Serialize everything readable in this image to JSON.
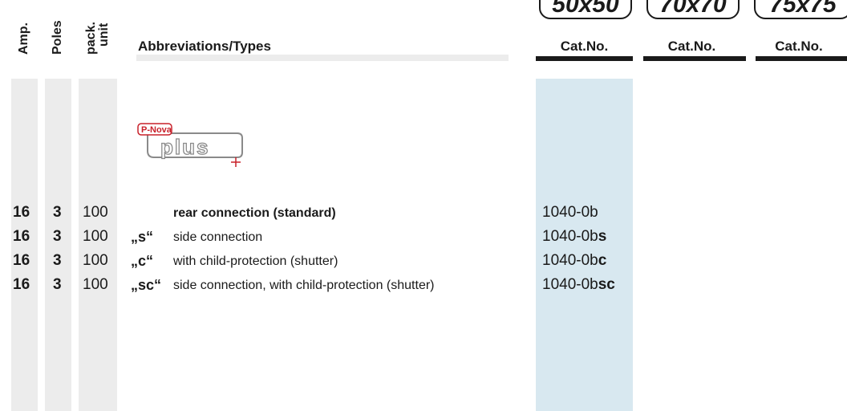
{
  "headers": {
    "amp": "Amp.",
    "poles": "Poles",
    "pack_unit": [
      "pack.",
      "unit"
    ],
    "abbreviations": "Abbreviations/Types",
    "sizes": [
      "50x50",
      "70x70",
      "75x75"
    ],
    "catno": "Cat.No."
  },
  "logo": {
    "brand": "P-Nova",
    "word": "plus"
  },
  "rows": [
    {
      "amp": "16",
      "poles": "3",
      "pack": "100",
      "code": "",
      "description": "rear connection (standard)",
      "cat_base": "1040-0b",
      "cat_suffix": ""
    },
    {
      "amp": "16",
      "poles": "3",
      "pack": "100",
      "code": "„s“",
      "description": "side connection",
      "cat_base": "1040-0b",
      "cat_suffix": "s"
    },
    {
      "amp": "16",
      "poles": "3",
      "pack": "100",
      "code": "„c“",
      "description": "with child-protection (shutter)",
      "cat_base": "1040-0b",
      "cat_suffix": "c"
    },
    {
      "amp": "16",
      "poles": "3",
      "pack": "100",
      "code": "„sc“",
      "description": "side connection, with child-protection (shutter)",
      "cat_base": "1040-0b",
      "cat_suffix": "sc"
    }
  ],
  "colors": {
    "highlight_column": "#d8e8f0",
    "stripe": "#ececec",
    "logo_red": "#c8202a",
    "logo_grey": "#8a8a8a"
  }
}
